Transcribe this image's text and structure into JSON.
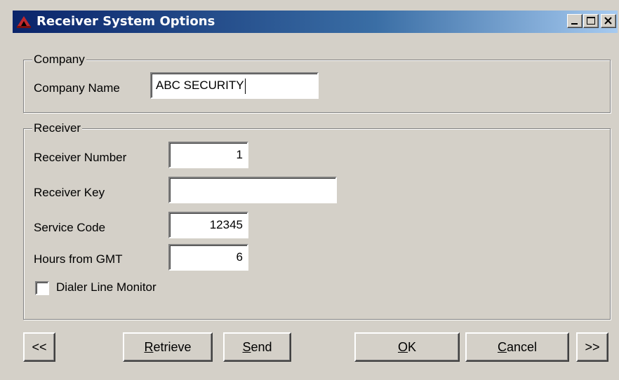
{
  "window": {
    "title": "Receiver System Options",
    "accent_color": "#0a246a",
    "title_icon": "app-logo-icon"
  },
  "company": {
    "legend": "Company",
    "name_label": "Company Name",
    "name_value": "ABC SECURITY"
  },
  "receiver": {
    "legend": "Receiver",
    "number_label": "Receiver Number",
    "number_value": "1",
    "key_label": "Receiver Key",
    "key_value": "",
    "service_label": "Service Code",
    "service_value": "12345",
    "gmt_label": "Hours from GMT",
    "gmt_value": "6",
    "dialer_label": "Dialer Line Monitor",
    "dialer_checked": false
  },
  "buttons": {
    "prev": "<<",
    "retrieve_acc": "R",
    "retrieve_rest": "etrieve",
    "send_acc": "S",
    "send_rest": "end",
    "ok_acc": "O",
    "ok_rest": "K",
    "cancel_acc": "C",
    "cancel_rest": "ancel",
    "next": ">>"
  }
}
